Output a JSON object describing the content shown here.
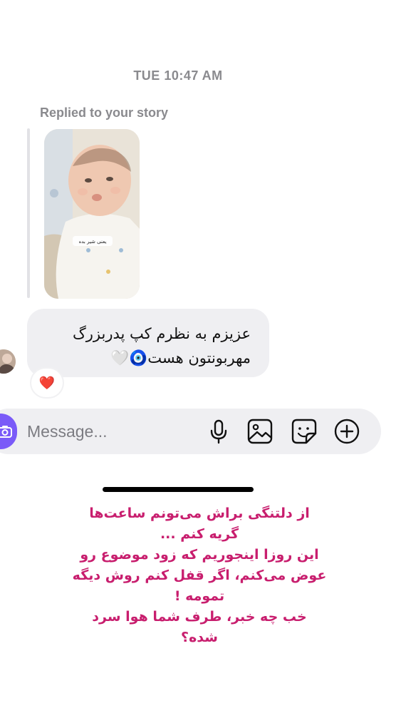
{
  "thread": {
    "timestamp": "TUE 10:47 AM",
    "replied_label": "Replied to your story",
    "story_sticker_text": "یعنی شیر بده",
    "message_text": "عزیزم به نظرم کپ پدربزرگ مهربونتون هست🧿🤍",
    "reaction": "❤️"
  },
  "composer": {
    "placeholder": "Message..."
  },
  "icons": {
    "camera": "camera-icon",
    "microphone": "microphone-icon",
    "gallery": "gallery-icon",
    "sticker": "sticker-icon",
    "add": "plus-circle-icon"
  },
  "caption": {
    "lines": [
      "از دلتنگی براش می‌تونم ساعت‌ها",
      "گریه کنم ...",
      "این روزا اینجوریم که زود موضوع رو",
      "عوض می‌کنم، اگر قفل کنم روش دیگه",
      "تمومه !",
      "خب چه خبر، طرف شما هوا سرد",
      "شده؟"
    ]
  },
  "colors": {
    "accent": "#7a5af8",
    "bubble": "#efeff2",
    "caption": "#c81e6e",
    "secondary_text": "#8a8a8e"
  }
}
